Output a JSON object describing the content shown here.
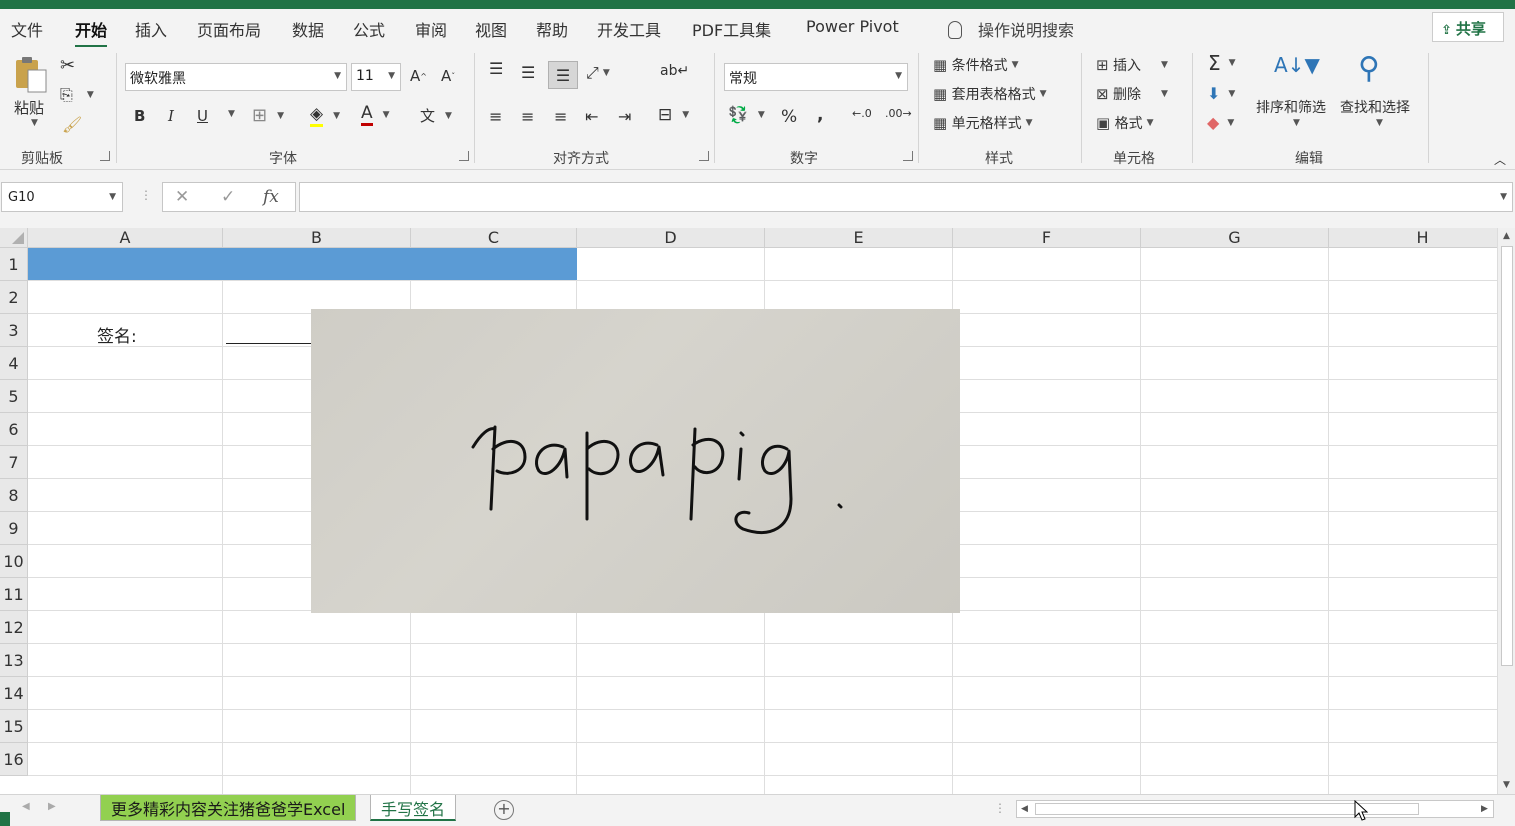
{
  "menu": {
    "tabs": [
      "文件",
      "开始",
      "插入",
      "页面布局",
      "数据",
      "公式",
      "审阅",
      "视图",
      "帮助",
      "开发工具",
      "PDF工具集",
      "Power Pivot"
    ],
    "active": "开始",
    "tell_me": "操作说明搜索",
    "share": "共享"
  },
  "ribbon": {
    "clipboard": {
      "label": "剪贴板",
      "paste": "粘贴"
    },
    "font": {
      "label": "字体",
      "name": "微软雅黑",
      "size": "11",
      "bold": "B",
      "italic": "I",
      "underline": "U"
    },
    "alignment": {
      "label": "对齐方式"
    },
    "number": {
      "label": "数字",
      "format": "常规",
      "percent": "%",
      "comma": ","
    },
    "styles": {
      "label": "样式",
      "conditional": "条件格式",
      "table": "套用表格格式",
      "cell": "单元格样式"
    },
    "cells": {
      "label": "单元格",
      "insert": "插入",
      "delete": "删除",
      "format": "格式"
    },
    "editing": {
      "label": "编辑",
      "sort": "排序和筛选",
      "find": "查找和选择",
      "sum": "Σ"
    }
  },
  "formula_bar": {
    "name_box": "G10",
    "fx": "fx",
    "value": ""
  },
  "grid": {
    "columns": [
      "A",
      "B",
      "C",
      "D",
      "E",
      "F",
      "G",
      "H"
    ],
    "rows": [
      "1",
      "2",
      "3",
      "4",
      "5",
      "6",
      "7",
      "8",
      "9",
      "10",
      "11",
      "12",
      "13",
      "14",
      "15",
      "16"
    ],
    "fill_color": "#5b9bd5",
    "cells": {
      "A3": "签名:"
    },
    "signature_text": "papapig."
  },
  "sheets": {
    "tabs": [
      "更多精彩内容关注猪爸爸学Excel",
      "手写签名"
    ],
    "active": "手写签名",
    "tab_color": "#92d050"
  },
  "colors": {
    "accent": "#217346"
  }
}
